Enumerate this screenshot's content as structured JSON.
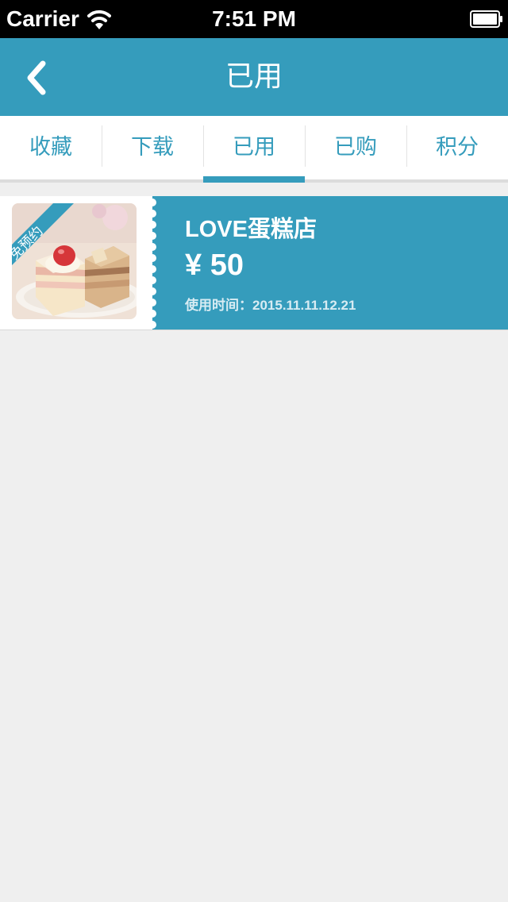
{
  "status_bar": {
    "carrier": "Carrier",
    "time": "7:51 PM"
  },
  "nav": {
    "title": "已用",
    "back_icon": "chevron-left-icon"
  },
  "tabs": [
    {
      "label": "收藏",
      "active": false
    },
    {
      "label": "下载",
      "active": false
    },
    {
      "label": "已用",
      "active": true
    },
    {
      "label": "已购",
      "active": false
    },
    {
      "label": "积分",
      "active": false
    }
  ],
  "coupons": [
    {
      "badge": "免预约",
      "shop": "LOVE蛋糕店",
      "price": "¥ 50",
      "used_time": "使用时间：2015.11.11.12.21"
    }
  ],
  "colors": {
    "accent": "#359cbc",
    "background": "#efefef"
  }
}
